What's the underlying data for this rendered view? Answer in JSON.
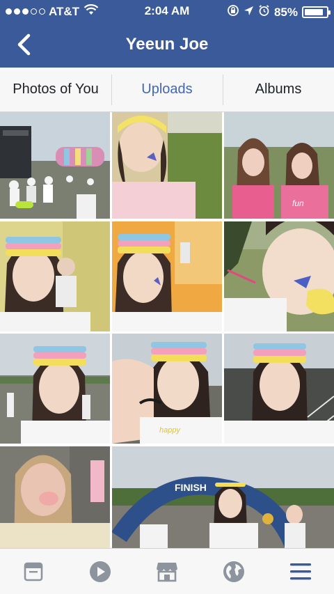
{
  "status_bar": {
    "carrier": "AT&T",
    "time": "2:04 AM",
    "battery": "85%",
    "battery_level": 0.85,
    "signal_bars_filled": 3,
    "signal_bars_total": 5
  },
  "nav": {
    "title": "Yeeun Joe",
    "back_icon": "chevron-left-icon"
  },
  "tabs": [
    {
      "label": "Photos of You",
      "active": false
    },
    {
      "label": "Uploads",
      "active": true
    },
    {
      "label": "Albums",
      "active": false
    }
  ],
  "photos": [
    {
      "scene": "outdoor event stage with crowd and inflatable arch"
    },
    {
      "scene": "girl in yellow headband selfie on grassy field"
    },
    {
      "scene": "two girls in pink shirts making faces"
    },
    {
      "scene": "girl with rainbow headband and colour powder"
    },
    {
      "scene": "girl selfie in orange colour powder"
    },
    {
      "scene": "girl close-up with paint on cheek"
    },
    {
      "scene": "girl with rainbow headband at running event"
    },
    {
      "scene": "girl showing tattooed wrist"
    },
    {
      "scene": "girl with rainbow headband in parking lot"
    },
    {
      "scene": "girl covered in colour powder"
    },
    {
      "scene": "girl with medal at finish line arch",
      "arch_text": "FINISH"
    }
  ],
  "bottom_bar": [
    {
      "icon": "news-feed-icon"
    },
    {
      "icon": "video-play-icon"
    },
    {
      "icon": "marketplace-icon"
    },
    {
      "icon": "globe-icon"
    },
    {
      "icon": "menu-icon"
    }
  ],
  "colors": {
    "header": "#3b5a99",
    "accent": "#4267b2",
    "icon_gray": "#8d949e",
    "icon_active": "#3b5a99"
  }
}
